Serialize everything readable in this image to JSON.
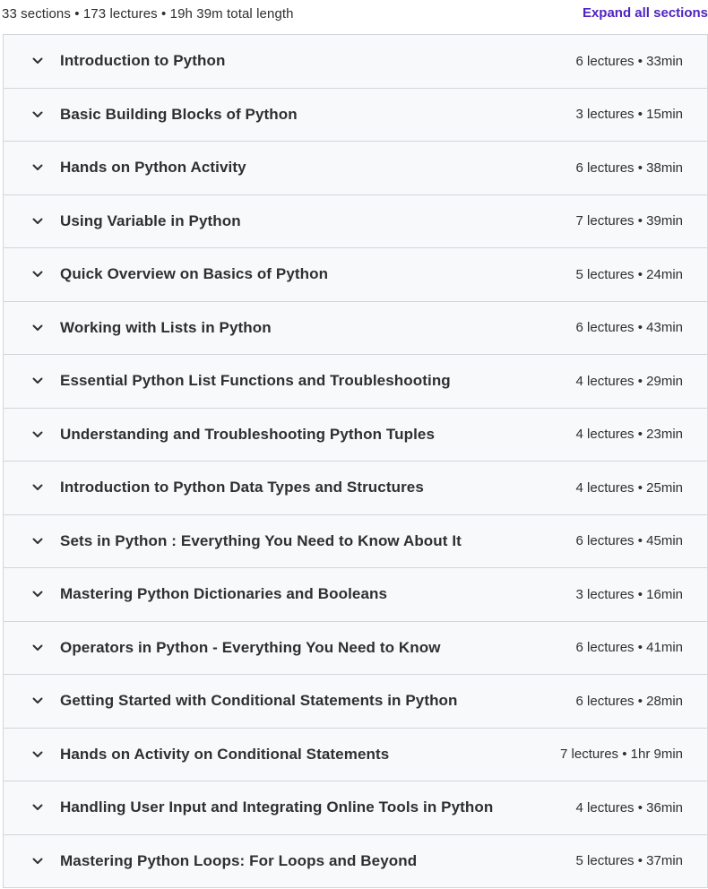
{
  "summary": {
    "text": "33 sections • 173 lectures • 19h 39m total length",
    "expand_label": "Expand all sections"
  },
  "colors": {
    "accent": "#5022c3",
    "row_background": "#f7f9fa",
    "border": "#d1d7dc",
    "text": "#2d2f31"
  },
  "icons": {
    "row_toggle": "chevron-down-icon"
  },
  "sections": [
    {
      "title": "Introduction to Python",
      "meta": "6 lectures • 33min"
    },
    {
      "title": "Basic Building Blocks of Python",
      "meta": "3 lectures • 15min"
    },
    {
      "title": "Hands on Python Activity",
      "meta": "6 lectures • 38min"
    },
    {
      "title": "Using Variable in Python",
      "meta": "7 lectures • 39min"
    },
    {
      "title": "Quick Overview on Basics of Python",
      "meta": "5 lectures • 24min"
    },
    {
      "title": "Working with Lists in Python",
      "meta": "6 lectures • 43min"
    },
    {
      "title": "Essential Python List Functions and Troubleshooting",
      "meta": "4 lectures • 29min"
    },
    {
      "title": "Understanding and Troubleshooting Python Tuples",
      "meta": "4 lectures • 23min"
    },
    {
      "title": "Introduction to Python Data Types and Structures",
      "meta": "4 lectures • 25min"
    },
    {
      "title": "Sets in Python : Everything You Need to Know About It",
      "meta": "6 lectures • 45min"
    },
    {
      "title": "Mastering Python Dictionaries and Booleans",
      "meta": "3 lectures • 16min"
    },
    {
      "title": "Operators in Python - Everything You Need to Know",
      "meta": "6 lectures • 41min"
    },
    {
      "title": "Getting Started with Conditional Statements in Python",
      "meta": "6 lectures • 28min"
    },
    {
      "title": "Hands on Activity on Conditional Statements",
      "meta": "7 lectures • 1hr 9min"
    },
    {
      "title": "Handling User Input and Integrating Online Tools in Python",
      "meta": "4 lectures • 36min"
    },
    {
      "title": "Mastering Python Loops: For Loops and Beyond",
      "meta": "5 lectures • 37min"
    }
  ]
}
